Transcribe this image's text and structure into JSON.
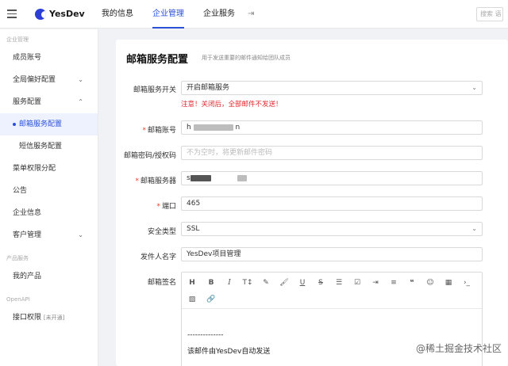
{
  "brand": {
    "name": "YesDev"
  },
  "topnav": [
    {
      "label": "我的信息"
    },
    {
      "label": "企业管理"
    },
    {
      "label": "企业服务"
    }
  ],
  "search": {
    "placeholder": "搜索 语"
  },
  "sidebar": {
    "group1": "企业管理",
    "items": [
      {
        "label": "成员账号"
      },
      {
        "label": "全局偏好配置"
      },
      {
        "label": "服务配置"
      },
      {
        "label": "邮箱服务配置"
      },
      {
        "label": "短信服务配置"
      },
      {
        "label": "菜单权限分配"
      },
      {
        "label": "公告"
      },
      {
        "label": "企业信息"
      },
      {
        "label": "客户管理"
      }
    ],
    "group2": "产品服务",
    "items2": [
      {
        "label": "我的产品"
      }
    ],
    "group3": "OpenAPI",
    "items3": [
      {
        "label": "接口权限",
        "tag": "[未开通]"
      }
    ]
  },
  "page": {
    "title": "邮箱服务配置",
    "subtitle": "用于发送重要的邮件通知给团队成员"
  },
  "form": {
    "switch_label": "邮箱服务开关",
    "switch_value": "开启邮箱服务",
    "warning": "注意！关闭后，全部邮件不发送！",
    "account_label": "邮箱账号",
    "account_prefix": "h",
    "account_suffix": "n",
    "password_label": "邮箱密码/授权码",
    "password_placeholder": "不为空时，将更新邮件密码",
    "server_label": "邮箱服务器",
    "server_prefix": "s",
    "port_label": "端口",
    "port_value": "465",
    "security_label": "安全类型",
    "security_value": "SSL",
    "sender_label": "发件人名字",
    "sender_value": "YesDev项目管理",
    "signature_label": "邮箱签名",
    "signature_separator": "--------------",
    "signature_text": "该邮件由YesDev自动发送"
  },
  "watermark": "@稀土掘金技术社区"
}
